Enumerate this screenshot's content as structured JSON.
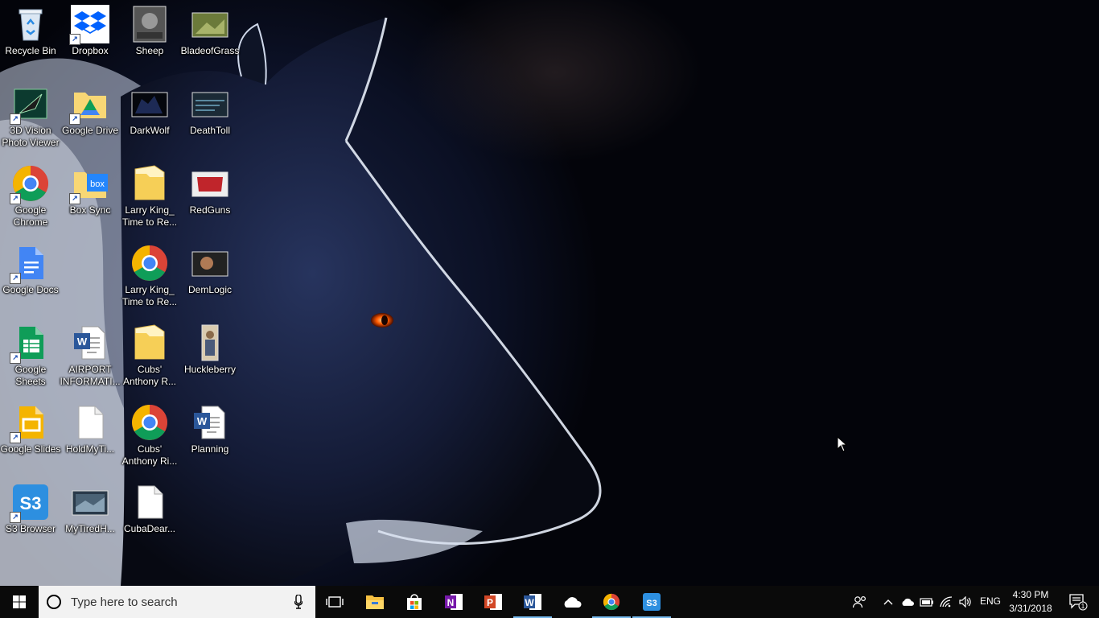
{
  "desktop": {
    "icons": [
      {
        "label": "Recycle Bin"
      },
      {
        "label": "Dropbox"
      },
      {
        "label": "Sheep"
      },
      {
        "label": "BladeofGrass"
      },
      {
        "label": "3D Vision Photo Viewer"
      },
      {
        "label": "Google Drive"
      },
      {
        "label": "DarkWolf"
      },
      {
        "label": "DeathToll"
      },
      {
        "label": "Google Chrome"
      },
      {
        "label": "Box Sync"
      },
      {
        "label": "Larry King_ Time to Re..."
      },
      {
        "label": "RedGuns"
      },
      {
        "label": "Google Docs"
      },
      {
        "label": "Larry King_ Time to Re..."
      },
      {
        "label": "DemLogic"
      },
      {
        "label": "Google Sheets"
      },
      {
        "label": "AIRPORT INFORMATI..."
      },
      {
        "label": "Cubs' Anthony R..."
      },
      {
        "label": "Huckleberry"
      },
      {
        "label": "Google Slides"
      },
      {
        "label": "HoldMyTi..."
      },
      {
        "label": "Cubs' Anthony Ri..."
      },
      {
        "label": "Planning"
      },
      {
        "label": "S3 Browser"
      },
      {
        "label": "MyTiredH..."
      },
      {
        "label": "CubaDear..."
      }
    ]
  },
  "taskbar": {
    "search_placeholder": "Type here to search",
    "pinned": [
      "task-view",
      "file-explorer",
      "microsoft-store",
      "onenote",
      "powerpoint",
      "word",
      "onedrive",
      "google-chrome",
      "s3-browser"
    ],
    "language": "ENG",
    "time": "4:30 PM",
    "date": "3/31/2018",
    "notification_count": "1",
    "accent": "#76b9ed"
  }
}
